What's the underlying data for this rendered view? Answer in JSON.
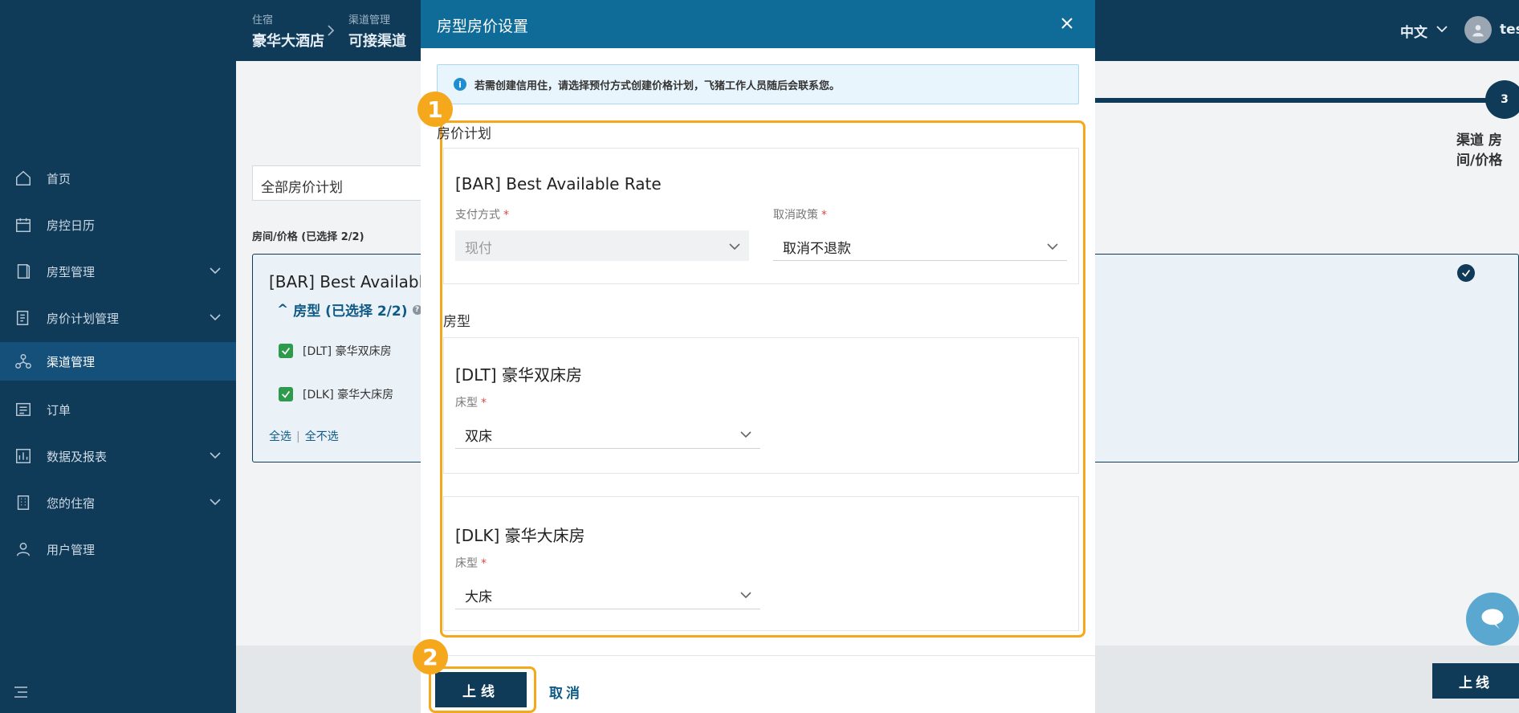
{
  "sidebar": {
    "items": [
      {
        "label": "首页",
        "icon": "home-icon"
      },
      {
        "label": "房控日历",
        "icon": "calendar-icon"
      },
      {
        "label": "房型管理",
        "icon": "room-icon"
      },
      {
        "label": "房价计划管理",
        "icon": "price-plan-icon"
      },
      {
        "label": "渠道管理",
        "icon": "channel-icon"
      },
      {
        "label": "订单",
        "icon": "order-icon"
      },
      {
        "label": "数据及报表",
        "icon": "report-icon"
      },
      {
        "label": "您的住宿",
        "icon": "building-icon"
      },
      {
        "label": "用户管理",
        "icon": "user-icon"
      }
    ]
  },
  "header": {
    "crumb1_small": "住宿",
    "crumb1_big": "豪华大酒店",
    "crumb2_small": "渠道管理",
    "crumb2_big": "可接渠道",
    "language": "中文",
    "username": "tes"
  },
  "background": {
    "step_number": "3",
    "step_label": "渠道 房间/价格",
    "plan_filter": "全部房价计划",
    "roomprice_label": "房间/价格 (已选择 2/2)",
    "card_title": "[BAR] Best Available",
    "room_type_toggle": "房型 (已选择 2/2)",
    "rooms": [
      "[DLT] 豪华双床房",
      "[DLK] 豪华大床房"
    ],
    "select_all": "全选",
    "deselect_all": "全不选",
    "online_button": "上线"
  },
  "modal": {
    "title": "房型房价设置",
    "info": "若需创建信用住，请选择预付方式创建价格计划，飞猪工作人员随后会联系您。",
    "rate_plan_section": "房价计划",
    "rate_plan": {
      "title": "[BAR] Best Available Rate",
      "payment_label": "支付方式",
      "payment_value": "现付",
      "cancel_label": "取消政策",
      "cancel_value": "取消不退款"
    },
    "room_type_section": "房型",
    "room_types": [
      {
        "title": "[DLT] 豪华双床房",
        "bed_label": "床型",
        "bed_value": "双床"
      },
      {
        "title": "[DLK] 豪华大床房",
        "bed_label": "床型",
        "bed_value": "大床"
      }
    ],
    "online_button": "上线",
    "cancel_button": "取消",
    "badge1": "1",
    "badge2": "2"
  },
  "colors": {
    "sidebar_bg": "#0f3a58",
    "modal_header": "#0f6b98",
    "highlight": "#f5a81c",
    "required": "#e04747"
  }
}
